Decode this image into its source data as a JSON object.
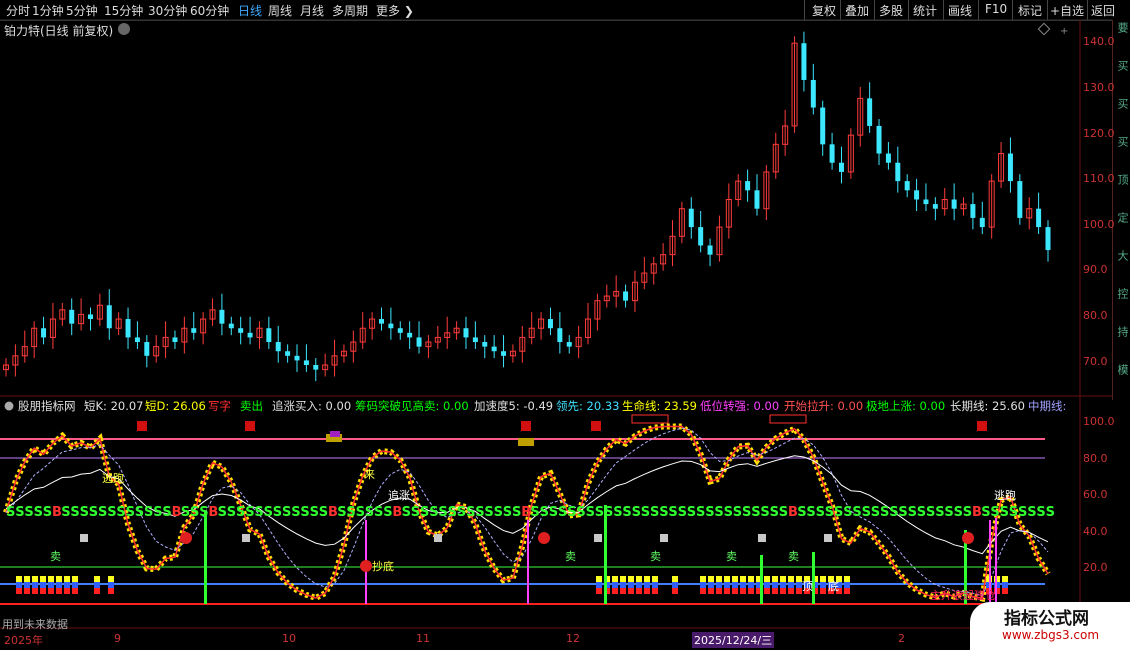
{
  "toolbar": {
    "periods": [
      "分时",
      "1分钟",
      "5分钟",
      "15分钟",
      "30分钟",
      "60分钟",
      "日线",
      "周线",
      "月线",
      "多周期",
      "更多"
    ],
    "active_period": "日线",
    "right_buttons": [
      "复权",
      "叠加",
      "多股",
      "统计",
      "画线",
      "F10",
      "标记",
      "+自选",
      "返回"
    ]
  },
  "stock": {
    "title": "铂力特(日线 前复权)"
  },
  "right_strip_text": [
    "要",
    "买",
    "买",
    "买",
    "顶",
    "定",
    "大",
    "控",
    "持",
    "模"
  ],
  "indicator": {
    "name": "股朋指标网",
    "items": [
      {
        "label": "短K: 20.07",
        "color": "#e0e0e0"
      },
      {
        "label": "短D: 26.06",
        "color": "#ffff00"
      },
      {
        "label": "写字",
        "color": "#ff3030"
      },
      {
        "label": "卖出",
        "color": "#00ff00"
      },
      {
        "label": "追涨买入: 0.00",
        "color": "#e0e0e0"
      },
      {
        "label": "筹码突破见高卖: 0.00",
        "color": "#00ff00"
      },
      {
        "label": "加速度5: -0.49",
        "color": "#e0e0e0"
      },
      {
        "label": "领先: 20.33",
        "color": "#40e0ff"
      },
      {
        "label": "生命线: 23.59",
        "color": "#ffff00"
      },
      {
        "label": "低位转强: 0.00",
        "color": "#ff40ff"
      },
      {
        "label": "开始拉升: 0.00",
        "color": "#ff5050"
      },
      {
        "label": "极地上涨: 0.00",
        "color": "#00ff00"
      },
      {
        "label": "长期线: 25.60",
        "color": "#e0e0e0"
      },
      {
        "label": "中期线:",
        "color": "#a0a0ff"
      }
    ]
  },
  "price_axis": [
    "140.0",
    "130.0",
    "120.0",
    "110.0",
    "100.0",
    "90.0",
    "80.0",
    "70.0"
  ],
  "ind_axis": [
    "100.0",
    "80.0",
    "60.0",
    "40.0",
    "20.0"
  ],
  "date_axis": [
    {
      "label": "2025年"
    },
    {
      "label": "9"
    },
    {
      "label": "10"
    },
    {
      "label": "11"
    },
    {
      "label": "12"
    },
    {
      "label": "2025/12/24/三"
    },
    {
      "label": "2"
    }
  ],
  "footer": "用到未来数据",
  "annotations": [
    "逃跑",
    "来",
    "追涨",
    "逃跑",
    "卖",
    "卖",
    "卖",
    "卖",
    "卖",
    "抄底",
    "顶",
    "底",
    "主升浪起建仓"
  ],
  "brand": {
    "name": "指标公式网",
    "url": "www.zbgs3.com"
  },
  "chart_data": {
    "type": "candlestick",
    "title": "铂力特(日线 前复权)",
    "ylim": [
      65,
      142
    ],
    "close": [
      70,
      72,
      74,
      78,
      76,
      80,
      82,
      79,
      81,
      80,
      83,
      78,
      80,
      76,
      75,
      72,
      74,
      76,
      75,
      78,
      77,
      80,
      82,
      79,
      78,
      77,
      76,
      78,
      75,
      73,
      72,
      71,
      70,
      69,
      70,
      72,
      73,
      75,
      78,
      80,
      79,
      78,
      77,
      76,
      74,
      75,
      76,
      77,
      78,
      76,
      75,
      74,
      73,
      72,
      73,
      76,
      78,
      80,
      78,
      75,
      74,
      76,
      80,
      84,
      85,
      86,
      84,
      88,
      90,
      92,
      94,
      98,
      104,
      100,
      96,
      94,
      100,
      106,
      110,
      108,
      104,
      112,
      118,
      122,
      140,
      132,
      126,
      118,
      114,
      112,
      120,
      128,
      122,
      116,
      114,
      110,
      108,
      106,
      105,
      104,
      106,
      104,
      105,
      102,
      100,
      110,
      116,
      110,
      102,
      104,
      100,
      95
    ]
  }
}
